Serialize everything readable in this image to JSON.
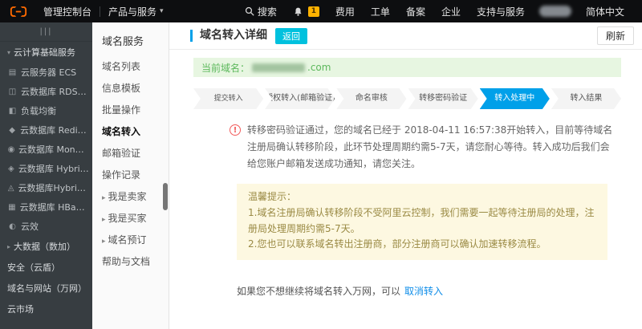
{
  "colors": {
    "accent_blue": "#00a0e9",
    "teal_button": "#00c1de",
    "green_bar_bg": "#e7f6e1",
    "green_text": "#5cb85c",
    "warning_red": "#f25b5b",
    "tip_bg": "#fdf8e1",
    "tip_text": "#9a8a44",
    "link_blue": "#108ee9",
    "badge_orange": "#ffb200"
  },
  "topbar": {
    "console_label": "管理控制台",
    "products_label": "产品与服务",
    "products_caret": "▾",
    "search_label": "搜索",
    "bell_badge": "1",
    "items": [
      "费用",
      "工单",
      "备案",
      "企业",
      "支持与服务"
    ],
    "language": "简体中文"
  },
  "sidebar": {
    "collapse_handle": "|||",
    "items": [
      {
        "caret": "▾",
        "label": "云计算基础服务",
        "type": "section"
      },
      {
        "icon": "▤",
        "label": "云服务器 ECS"
      },
      {
        "icon": "◫",
        "label": "云数据库 RDS 版"
      },
      {
        "icon": "◧",
        "label": "负载均衡"
      },
      {
        "icon": "◆",
        "label": "云数据库 Redis 版"
      },
      {
        "icon": "◉",
        "label": "云数据库 MongoDB 版"
      },
      {
        "icon": "◈",
        "label": "云数据库 HybridDB f..."
      },
      {
        "icon": "◬",
        "label": "云数据库HybridDB fo..."
      },
      {
        "icon": "▦",
        "label": "云数据库 HBase 版"
      },
      {
        "icon": "◐",
        "label": "云效"
      },
      {
        "caret": "▸",
        "label": "大数据（数加）",
        "type": "section"
      },
      {
        "label": "安全（云盾）",
        "type": "section"
      },
      {
        "label": "域名与网站（万网）",
        "type": "section"
      },
      {
        "label": "云市场",
        "type": "section"
      }
    ]
  },
  "menu": {
    "title": "域名服务",
    "items": [
      {
        "label": "域名列表"
      },
      {
        "label": "信息模板"
      },
      {
        "label": "批量操作"
      },
      {
        "label": "域名转入",
        "active": true
      },
      {
        "label": "邮箱验证"
      },
      {
        "label": "操作记录"
      },
      {
        "caret": "▸",
        "label": "我是卖家"
      },
      {
        "caret": "▸",
        "label": "我是买家"
      },
      {
        "caret": "▸",
        "label": "域名预订"
      },
      {
        "label": "帮助与文档"
      }
    ]
  },
  "main": {
    "title": "域名转入详细",
    "back_button": "返回",
    "refresh_button": "刷新",
    "domain_label": "当前域名：",
    "domain_suffix": ".com",
    "steps": [
      {
        "label": "提交转入"
      },
      {
        "label": "授权转入(邮箱验证)"
      },
      {
        "label": "命名审核"
      },
      {
        "label": "转移密码验证"
      },
      {
        "label": "转入处理中",
        "active": true
      },
      {
        "label": "转入结果"
      }
    ],
    "warning_text": "转移密码验证通过，您的域名已经于 2018-04-11 16:57:38开始转入，目前等待域名注册局确认转移阶段，此环节处理周期约需5-7天，请您耐心等待。转入成功后我们会给您账户邮箱发送成功通知，请您关注。",
    "tip": {
      "title": "温馨提示：",
      "lines": [
        "1.域名注册局确认转移阶段不受阿里云控制，我们需要一起等待注册局的处理，注册局处理周期约需5-7天。",
        "2.您也可以联系域名转出注册商，部分注册商可以确认加速转移流程。"
      ]
    },
    "cancel_line": "如果您不想继续将域名转入万网，可以",
    "cancel_link": "取消转入"
  }
}
